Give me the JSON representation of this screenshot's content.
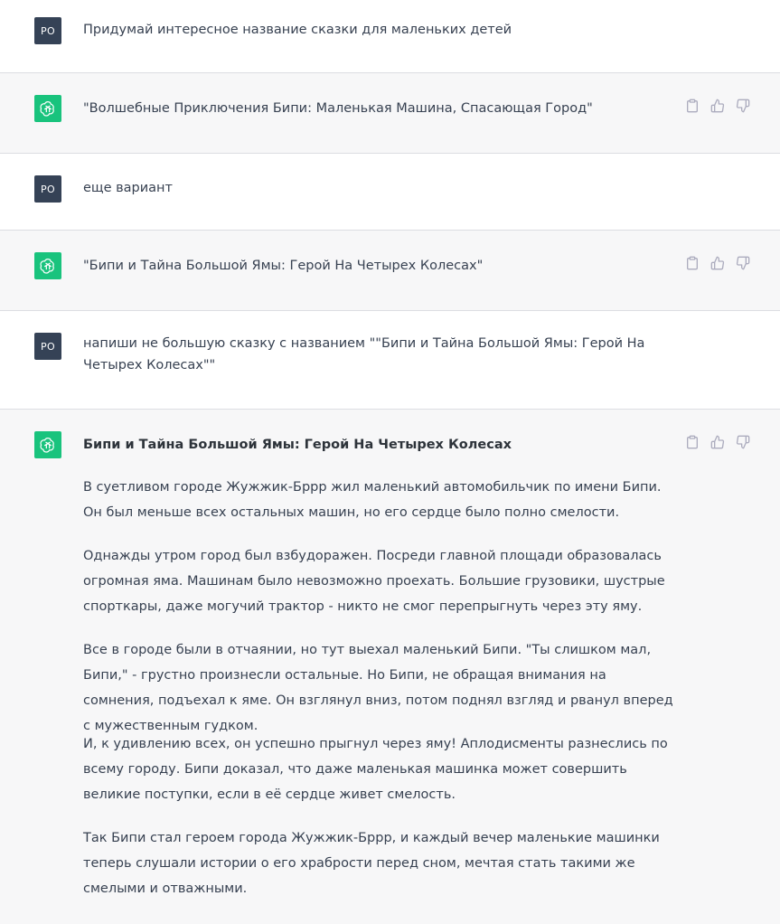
{
  "user": {
    "initials": "PO"
  },
  "conversation": {
    "m1": {
      "text": "Придумай интересное название сказки для маленьких детей"
    },
    "m2": {
      "text": "\"Волшебные Приключения Бипи: Маленькая Машина, Спасающая Город\""
    },
    "m3": {
      "text": "еще вариант"
    },
    "m4": {
      "text": "\"Бипи и Тайна Большой Ямы: Герой На Четырех Колесах\""
    },
    "m5": {
      "text": "напиши не большую сказку с названием \"\"Бипи и Тайна Большой Ямы: Герой На Четырех Колесах\"\""
    },
    "m6": {
      "title": "Бипи и Тайна Большой Ямы: Герой На Четырех Колесах",
      "paragraphs": [
        "В суетливом городе Жужжик-Бррр жил маленький автомобильчик по имени Бипи. Он был меньше всех остальных машин, но его сердце было полно смелости.",
        "Однажды утром город был взбудоражен. Посреди главной площади образовалась огромная яма. Машинам было невозможно проехать. Большие грузовики, шустрые спорткары, даже могучий трактор - никто не смог перепрыгнуть через эту яму.",
        "Все в городе были в отчаянии, но тут выехал маленький Бипи. \"Ты слишком мал, Бипи,\" - грустно произнесли остальные. Но Бипи, не обращая внимания на сомнения, подъехал к яме. Он взглянул вниз, потом поднял взгляд и рванул вперед с мужественным гудком.",
        "И, к удивлению всех, он успешно прыгнул через яму! Аплодисменты разнеслись по всему городу. Бипи доказал, что даже маленькая машинка может совершить великие поступки, если в её сердце живет смелость.",
        "Так Бипи стал героем города Жужжик-Бррр, и каждый вечер маленькие машинки теперь слушали истории о его храбрости перед сном, мечтая стать такими же смелыми и отважными."
      ]
    }
  },
  "icons": {
    "copy": "clipboard-icon",
    "like": "thumbs-up-icon",
    "dislike": "thumbs-down-icon",
    "bot": "openai-logo-icon"
  },
  "colors": {
    "user_avatar": "#354256",
    "bot_avatar": "#19c37d",
    "assistant_bg": "#f7f7f8",
    "text": "#374151",
    "icon": "#acacbe"
  }
}
